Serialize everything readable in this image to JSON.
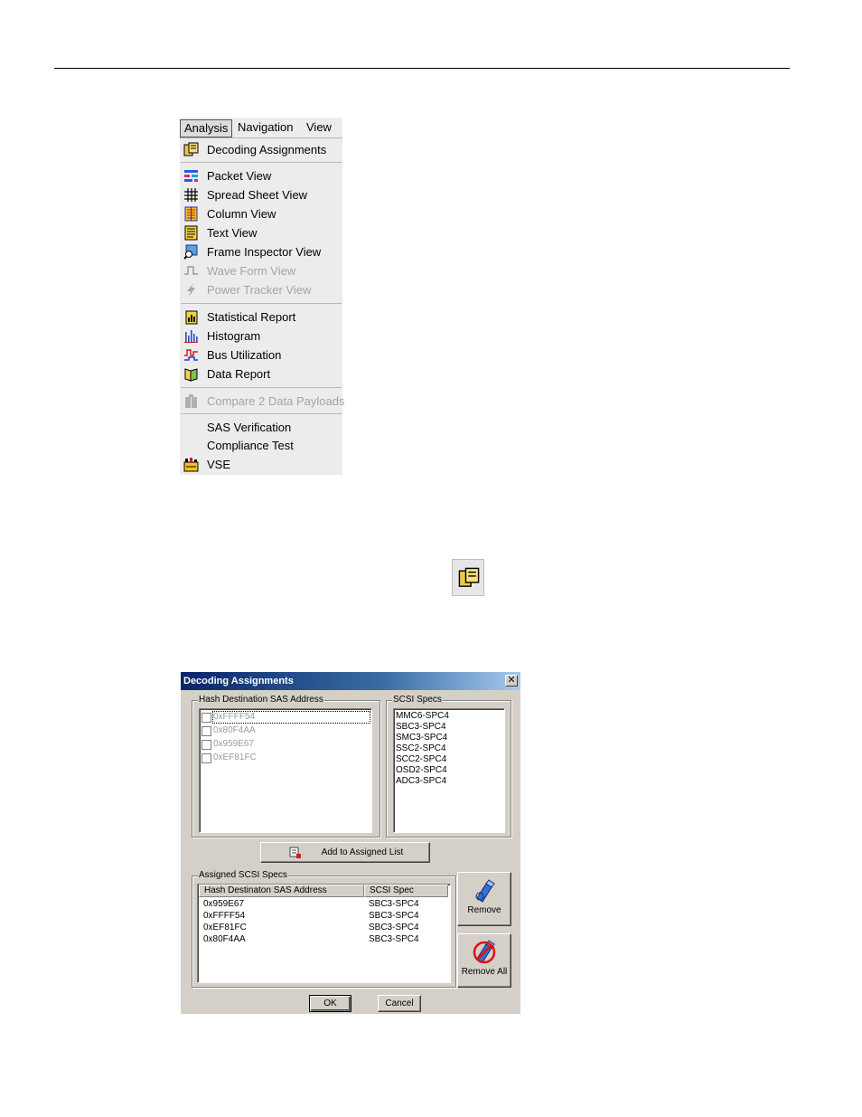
{
  "menu": {
    "bar": [
      "Analysis",
      "Navigation",
      "View"
    ],
    "items": [
      {
        "label": "Decoding Assignments",
        "icon": "decoding-assignments-icon",
        "enabled": true
      },
      {
        "label": "Packet View",
        "icon": "packet-view-icon",
        "enabled": true
      },
      {
        "label": "Spread Sheet View",
        "icon": "spreadsheet-grid-icon",
        "enabled": true
      },
      {
        "label": "Column View",
        "icon": "column-view-icon",
        "enabled": true
      },
      {
        "label": "Text View",
        "icon": "text-view-icon",
        "enabled": true
      },
      {
        "label": "Frame Inspector View",
        "icon": "frame-inspector-icon",
        "enabled": true
      },
      {
        "label": "Wave Form View",
        "icon": "waveform-icon",
        "enabled": false
      },
      {
        "label": "Power Tracker View",
        "icon": "lightning-icon",
        "enabled": false
      },
      {
        "label": "Statistical Report",
        "icon": "statistical-report-icon",
        "enabled": true
      },
      {
        "label": "Histogram",
        "icon": "histogram-icon",
        "enabled": true
      },
      {
        "label": "Bus Utilization",
        "icon": "bus-utilization-icon",
        "enabled": true
      },
      {
        "label": "Data Report",
        "icon": "data-report-icon",
        "enabled": true
      },
      {
        "label": "Compare 2 Data Payloads",
        "icon": "compare-icon",
        "enabled": false
      },
      {
        "label": "SAS Verification",
        "icon": "",
        "enabled": true
      },
      {
        "label": "Compliance Test",
        "icon": "",
        "enabled": true
      },
      {
        "label": "VSE",
        "icon": "vse-icon",
        "enabled": true
      }
    ]
  },
  "dialog": {
    "title": "Decoding Assignments",
    "close_glyph": "✕",
    "hash_group_label": "Hash Destination SAS Address",
    "hash_addresses": [
      "0xFFFF54",
      "0x80F4AA",
      "0x959E67",
      "0xEF81FC"
    ],
    "specs_group_label": "SCSI Specs",
    "specs": [
      "MMC6-SPC4",
      "SBC3-SPC4",
      "SMC3-SPC4",
      "SSC2-SPC4",
      "SCC2-SPC4",
      "OSD2-SPC4",
      "ADC3-SPC4"
    ],
    "add_button": "Add  to Assigned List",
    "assigned_group_label": "Assigned SCSI Specs",
    "columns": [
      "Hash Destinaton SAS Address",
      "SCSI Spec"
    ],
    "rows": [
      [
        "0x959E67",
        "SBC3-SPC4"
      ],
      [
        "0xFFFF54",
        "SBC3-SPC4"
      ],
      [
        "0xEF81FC",
        "SBC3-SPC4"
      ],
      [
        "0x80F4AA",
        "SBC3-SPC4"
      ]
    ],
    "remove_button": "Remove",
    "remove_all_button": "Remove All",
    "ok_button": "OK",
    "cancel_button": "Cancel"
  }
}
